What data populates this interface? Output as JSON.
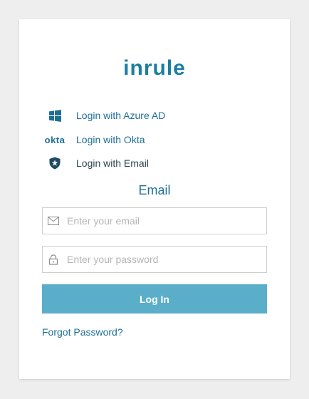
{
  "brand": {
    "logo_text": "inrule"
  },
  "providers": [
    {
      "label": "Login with Azure AD",
      "icon": "windows-icon"
    },
    {
      "label": "Login with Okta",
      "icon": "okta-logo",
      "icon_text": "okta"
    },
    {
      "label": "Login with Email",
      "icon": "auth0-shield-icon"
    }
  ],
  "email_section": {
    "title": "Email"
  },
  "form": {
    "email_placeholder": "Enter your email",
    "email_value": "",
    "password_placeholder": "Enter your password",
    "password_value": "",
    "submit_label": "Log In",
    "forgot_label": "Forgot Password?"
  },
  "colors": {
    "accent": "#1e6f96",
    "brand": "#1a7fa0",
    "button": "#5aaeca",
    "background": "#eeeeee"
  }
}
